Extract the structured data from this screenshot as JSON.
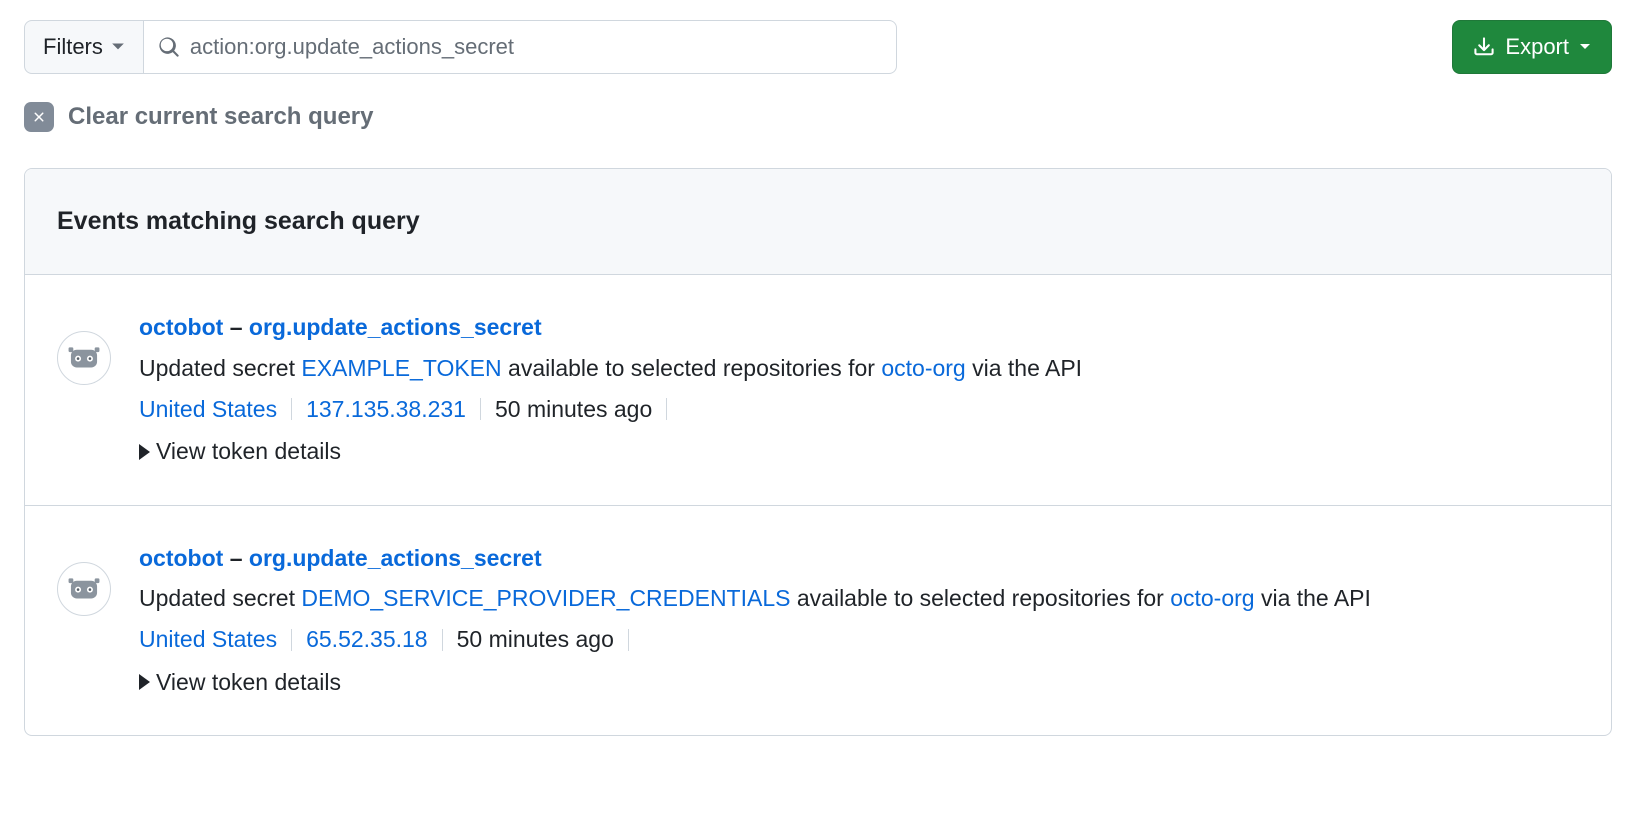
{
  "toolbar": {
    "filters_label": "Filters",
    "search_value": "action:org.update_actions_secret",
    "export_label": "Export"
  },
  "clear": {
    "label": "Clear current search query"
  },
  "results": {
    "header": "Events matching search query",
    "events": [
      {
        "actor": "octobot",
        "separator": " – ",
        "action": "org.update_actions_secret",
        "desc_prefix": "Updated secret ",
        "secret_name": "EXAMPLE_TOKEN",
        "desc_mid": " available to selected repositories for ",
        "org": "octo-org",
        "desc_suffix": " via the API",
        "location": "United States",
        "ip": "137.135.38.231",
        "time": "50 minutes ago",
        "details_label": "View token details"
      },
      {
        "actor": "octobot",
        "separator": " – ",
        "action": "org.update_actions_secret",
        "desc_prefix": "Updated secret ",
        "secret_name": "DEMO_SERVICE_PROVIDER_CREDENTIALS",
        "desc_mid": " available to selected repositories for ",
        "org": "octo-org",
        "desc_suffix": " via the API",
        "location": "United States",
        "ip": "65.52.35.18",
        "time": "50 minutes ago",
        "details_label": "View token details"
      }
    ]
  }
}
